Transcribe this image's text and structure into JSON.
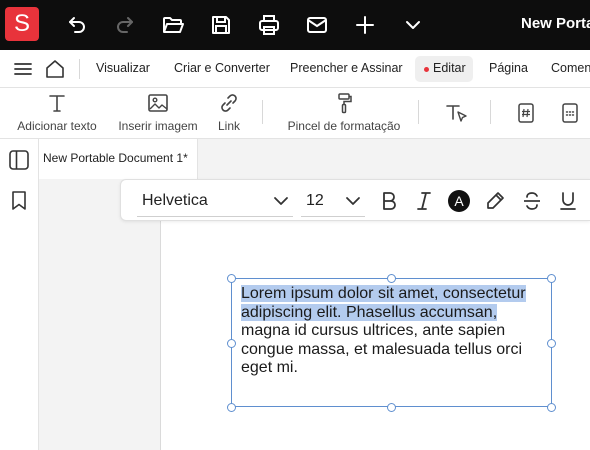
{
  "app": {
    "logo_letter": "S",
    "document_title": "New Portable Document 1"
  },
  "colors": {
    "brand": "#e8333b",
    "titlebar": "#0d0d0d",
    "selection": "#b3cbee",
    "frame": "#5f8fcf"
  },
  "titlebar_icons": [
    "undo-icon",
    "redo-icon",
    "open-folder-icon",
    "save-icon",
    "print-icon",
    "mail-icon",
    "add-icon",
    "chevron-down-icon"
  ],
  "menu": {
    "items": [
      "Visualizar",
      "Criar e Converter",
      "Preencher e Assinar",
      "Editar",
      "Página",
      "Comentário"
    ],
    "active": "Editar"
  },
  "ribbon": {
    "add_text": "Adicionar texto",
    "insert_image": "Inserir imagem",
    "link": "Link",
    "format_painter": "Pincel de formatação"
  },
  "tab": {
    "label": "New Portable Document 1*"
  },
  "format_toolbar": {
    "font": "Helvetica",
    "size": "12",
    "text_color_letter": "A"
  },
  "textbox": {
    "selected_text": "Lorem ipsum dolor sit amet, consectetur adipiscing elit. Phasellus accumsan,",
    "remaining_text": " magna id cursus ultrices, ante sapien congue massa, et malesuada tellus orci eget mi."
  }
}
